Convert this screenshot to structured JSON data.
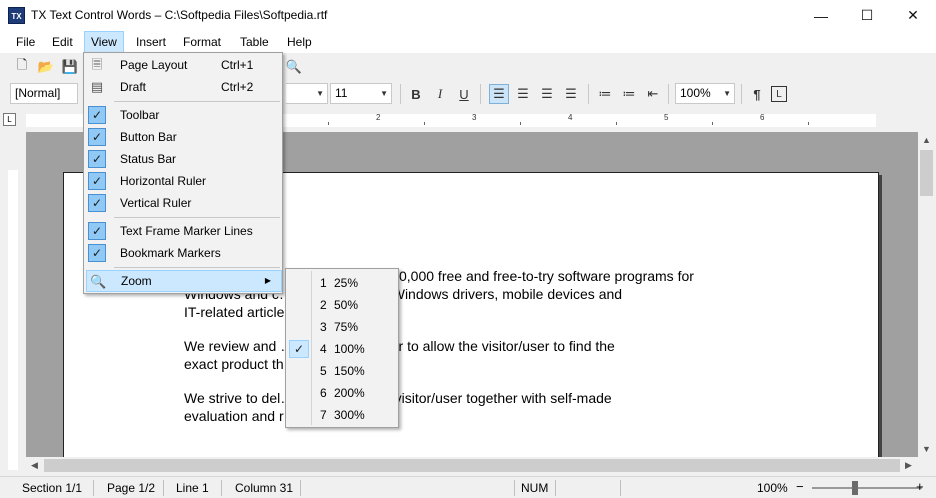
{
  "window": {
    "icon_text": "TX",
    "title": "TX Text Control Words – C:\\Softpedia Files\\Softpedia.rtf",
    "minimize": "—",
    "maximize": "☐",
    "close": "✕"
  },
  "menubar": {
    "items": [
      "File",
      "Edit",
      "View",
      "Insert",
      "Format",
      "Table",
      "Help"
    ]
  },
  "toolbar": {
    "style_value": "[Normal]",
    "font_size_value": "11",
    "zoom_value": "100%",
    "bold": "B",
    "italic": "I",
    "underline": "U",
    "pilcrow": "¶"
  },
  "ruler": {
    "corner": "L",
    "numbers": [
      "1",
      "2",
      "3",
      "4",
      "5",
      "6"
    ]
  },
  "document": {
    "paragraphs": [
      "0,000 free and free-to-try software programs for",
      "Windows and c…, Mac software, Windows drivers, mobile devices and",
      "IT-related article",
      "We review and … products in order to allow the visitor/user to find the",
      "exact product th… em needs.",
      "We strive to del… products to the visitor/user together with self-made",
      "evaluation and r"
    ]
  },
  "view_menu": {
    "items": [
      {
        "label": "Page Layout",
        "shortcut": "Ctrl+1",
        "icon": "page-layout-icon"
      },
      {
        "label": "Draft",
        "shortcut": "Ctrl+2",
        "icon": "draft-icon"
      },
      {
        "label": "Toolbar",
        "checked": true
      },
      {
        "label": "Button Bar",
        "checked": true
      },
      {
        "label": "Status Bar",
        "checked": true
      },
      {
        "label": "Horizontal Ruler",
        "checked": true
      },
      {
        "label": "Vertical Ruler",
        "checked": true
      },
      {
        "label": "Text Frame Marker Lines",
        "checked": true
      },
      {
        "label": "Bookmark Markers",
        "checked": true
      },
      {
        "label": "Zoom",
        "icon": "magnifier-icon",
        "submenu": true
      }
    ]
  },
  "zoom_menu": {
    "items": [
      {
        "num": "1",
        "label": "25%"
      },
      {
        "num": "2",
        "label": "50%"
      },
      {
        "num": "3",
        "label": "75%"
      },
      {
        "num": "4",
        "label": "100%",
        "checked": true
      },
      {
        "num": "5",
        "label": "150%"
      },
      {
        "num": "6",
        "label": "200%"
      },
      {
        "num": "7",
        "label": "300%"
      }
    ]
  },
  "statusbar": {
    "section": "Section 1/1",
    "page": "Page 1/2",
    "line": "Line 1",
    "column": "Column 31",
    "num": "NUM",
    "zoom": "100%",
    "zoom_level": 1.0
  },
  "colors": {
    "menu_highlight": "#cce8ff",
    "check_bg": "#90c8f6",
    "canvas": "#a0a0a0"
  }
}
